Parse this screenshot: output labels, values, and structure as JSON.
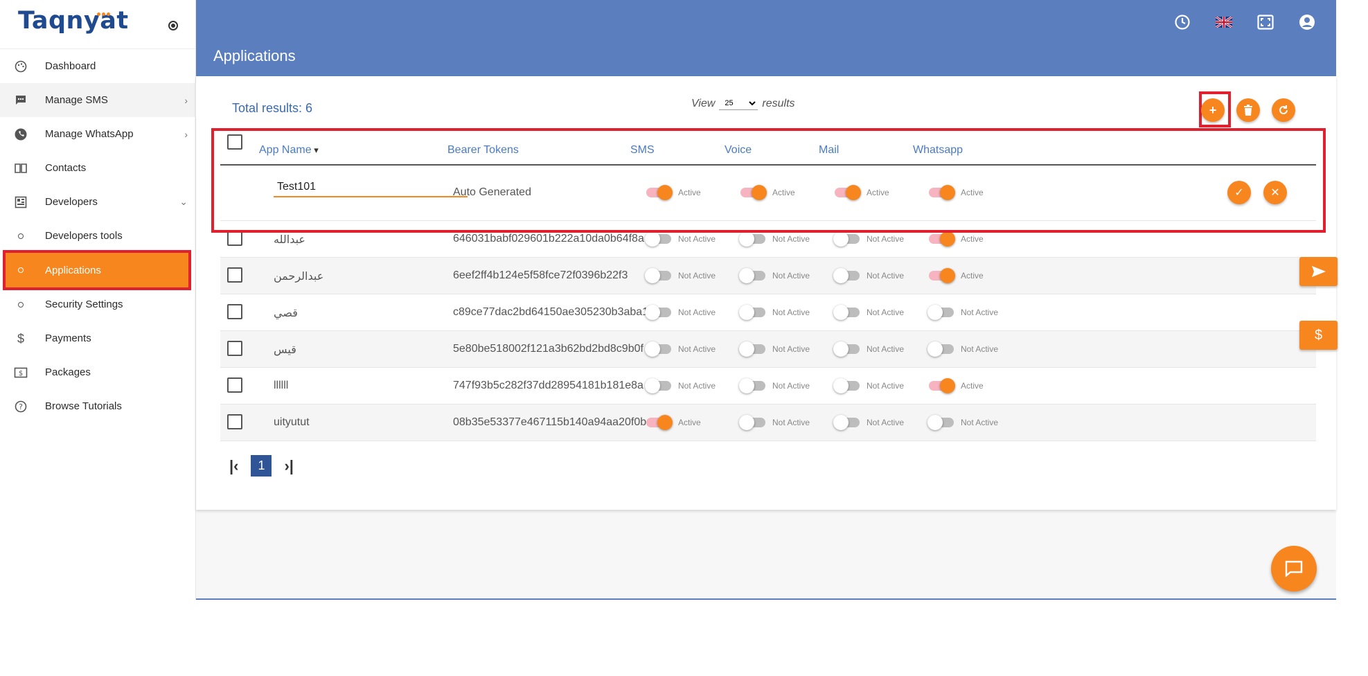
{
  "app": {
    "logo_text": "Taqnyat"
  },
  "sidebar": {
    "items": [
      {
        "label": "Dashboard"
      },
      {
        "label": "Manage SMS"
      },
      {
        "label": "Manage WhatsApp"
      },
      {
        "label": "Contacts"
      },
      {
        "label": "Developers"
      },
      {
        "label": "Developers tools"
      },
      {
        "label": "Applications"
      },
      {
        "label": "Security Settings"
      },
      {
        "label": "Payments"
      },
      {
        "label": "Packages"
      },
      {
        "label": "Browse Tutorials"
      }
    ]
  },
  "header": {
    "title": "Applications"
  },
  "toolbar": {
    "total_results": "Total results: 6",
    "view_label": "View",
    "view_value": "25",
    "results_label": "results"
  },
  "table": {
    "columns": [
      "App Name",
      "Bearer Tokens",
      "SMS",
      "Voice",
      "Mail",
      "Whatsapp"
    ],
    "edit_row": {
      "name": "Test101",
      "token": "Auto Generated",
      "sms": "Active",
      "voice": "Active",
      "mail": "Active",
      "whatsapp": "Active"
    },
    "rows": [
      {
        "name": "عبدالله",
        "token": "646031babf029601b222a10da0b64f8a",
        "sms": "Not Active",
        "voice": "Not Active",
        "mail": "Not Active",
        "whatsapp": "Active"
      },
      {
        "name": "عبدالرحمن",
        "token": "6eef2ff4b124e5f58fce72f0396b22f3",
        "sms": "Not Active",
        "voice": "Not Active",
        "mail": "Not Active",
        "whatsapp": "Active"
      },
      {
        "name": "قصي",
        "token": "c89ce77dac2bd64150ae305230b3aba1",
        "sms": "Not Active",
        "voice": "Not Active",
        "mail": "Not Active",
        "whatsapp": "Not Active"
      },
      {
        "name": "قيس",
        "token": "5e80be518002f121a3b62bd2bd8c9b0f",
        "sms": "Not Active",
        "voice": "Not Active",
        "mail": "Not Active",
        "whatsapp": "Not Active"
      },
      {
        "name": "llllll",
        "token": "747f93b5c282f37dd28954181b181e8a",
        "sms": "Not Active",
        "voice": "Not Active",
        "mail": "Not Active",
        "whatsapp": "Active"
      },
      {
        "name": "uityutut",
        "token": "08b35e53377e467115b140a94aa20f0b",
        "sms": "Active",
        "voice": "Not Active",
        "mail": "Not Active",
        "whatsapp": "Not Active"
      }
    ]
  },
  "pagination": {
    "current": "1"
  },
  "colors": {
    "primary": "#5b7fbe",
    "accent": "#f7861f",
    "highlight": "#e0202e",
    "link": "#4a7bc2"
  },
  "icons": [
    "history-icon",
    "uk-flag-icon",
    "fullscreen-icon",
    "account-icon",
    "plus-icon",
    "trash-icon",
    "refresh-icon",
    "check-icon",
    "close-icon",
    "send-icon",
    "dollar-icon",
    "chat-icon"
  ]
}
